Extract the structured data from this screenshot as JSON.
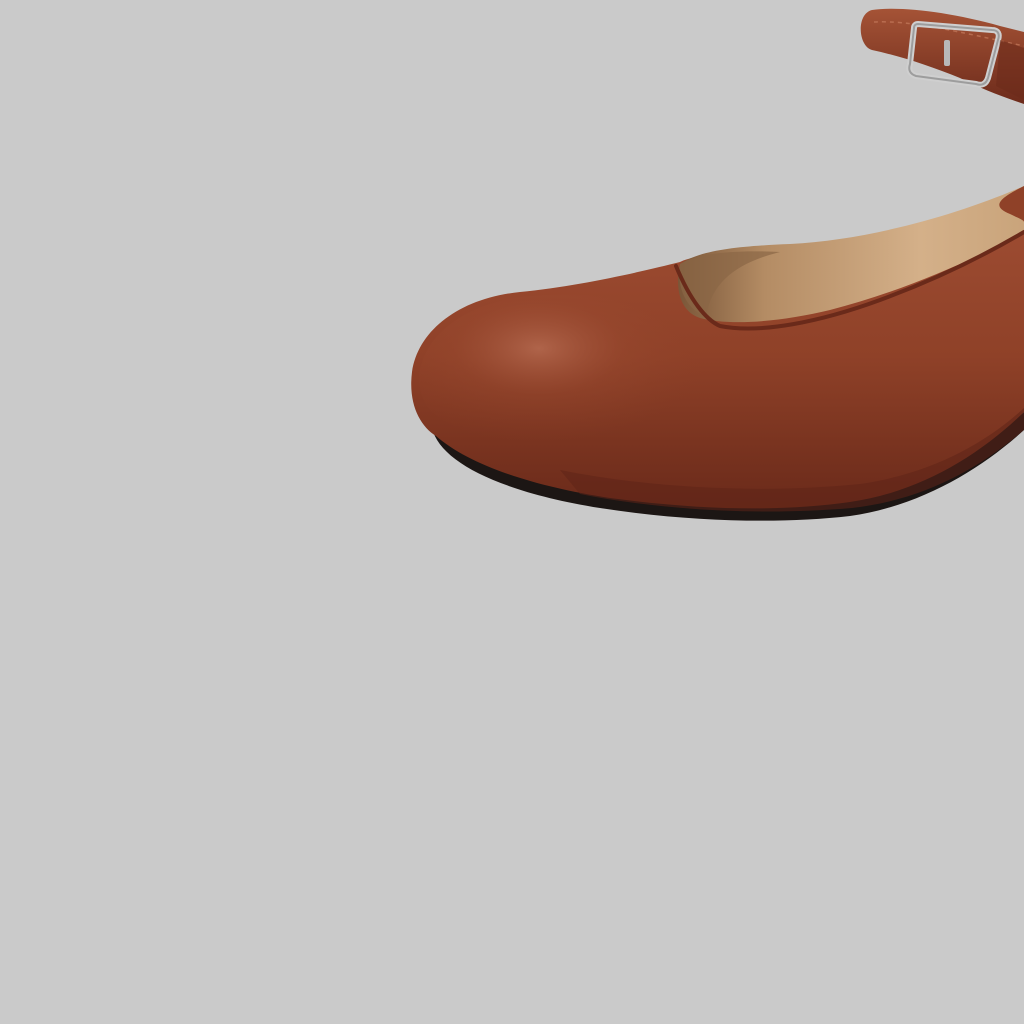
{
  "scene": {
    "subject": "shoe-icon",
    "colors": {
      "background": "#cacaca",
      "leather": "#8f4128",
      "leather_highlight": "#b2634a",
      "leather_shadow": "#5e2417",
      "lining": "#c8a27a",
      "lining_shadow": "#8a6646",
      "sole": "#1c1614",
      "buckle_metal": "#c9c9c9"
    }
  }
}
